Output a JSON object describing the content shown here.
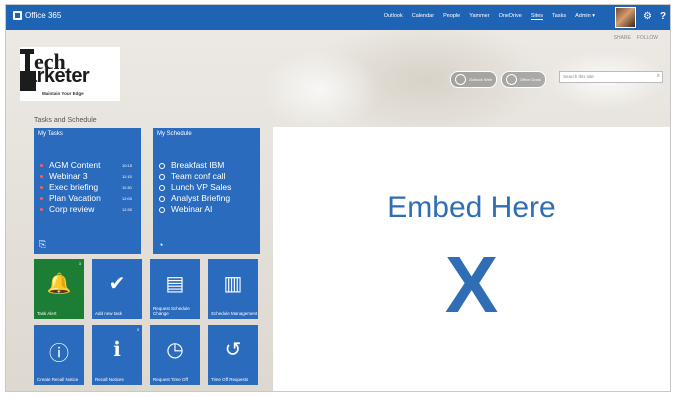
{
  "suitebar": {
    "product": "Office 365",
    "nav": [
      "Outlook",
      "Calendar",
      "People",
      "Yammer",
      "OneDrive",
      "Sites",
      "Tasks",
      "Admin ▾"
    ],
    "active_nav": "Sites"
  },
  "share": {
    "share_label": "SHARE",
    "follow_label": "FOLLOW"
  },
  "logo": {
    "line1": "ech",
    "line2": "arketer",
    "tagline": "Maintain Your Edge"
  },
  "apps": [
    {
      "label": "Outlook Web"
    },
    {
      "label": "Office Docs"
    }
  ],
  "search": {
    "placeholder": "Search this site"
  },
  "section_title": "Tasks and Schedule",
  "my_tasks": {
    "title": "My Tasks",
    "items": [
      {
        "label": "AGM Content",
        "time": "10:15"
      },
      {
        "label": "Webinar 3",
        "time": "11:15"
      },
      {
        "label": "Exec briefing",
        "time": "11:30"
      },
      {
        "label": "Plan Vacation",
        "time": "12:00"
      },
      {
        "label": "Corp review",
        "time": "12:30"
      }
    ]
  },
  "my_schedule": {
    "title": "My Schedule",
    "items": [
      "Breakfast IBM",
      "Team conf call",
      "Lunch VP Sales",
      "Analyst Briefing",
      "Webinar AI"
    ]
  },
  "tiles": [
    {
      "label": "Task Alert",
      "icon": "bell-icon",
      "color": "#1c7d34",
      "count": "3"
    },
    {
      "label": "Add new task",
      "icon": "check-add-icon",
      "color": "#2b6bbd",
      "count": ""
    },
    {
      "label": "Request Schedule Change",
      "icon": "document-edit-icon",
      "color": "#2b6bbd",
      "count": ""
    },
    {
      "label": "Schedule Management",
      "icon": "document-icon",
      "color": "#2b6bbd",
      "count": ""
    },
    {
      "label": "Create Recall Notice",
      "icon": "info-doc-icon",
      "color": "#2b6bbd",
      "count": ""
    },
    {
      "label": "Recall Notices",
      "icon": "info-icon",
      "color": "#2b6bbd",
      "count": "3"
    },
    {
      "label": "Request Time Off",
      "icon": "clock-add-icon",
      "color": "#2b6bbd",
      "count": ""
    },
    {
      "label": "Time Off Requests",
      "icon": "history-icon",
      "color": "#2b6bbd",
      "count": ""
    }
  ],
  "embed": {
    "title": "Embed Here",
    "mark": "X"
  },
  "colors": {
    "suitebar": "#1f63b4",
    "tile_blue": "#2b6bbd",
    "tile_green": "#1c7d34",
    "embed_text": "#2f6eb5"
  }
}
